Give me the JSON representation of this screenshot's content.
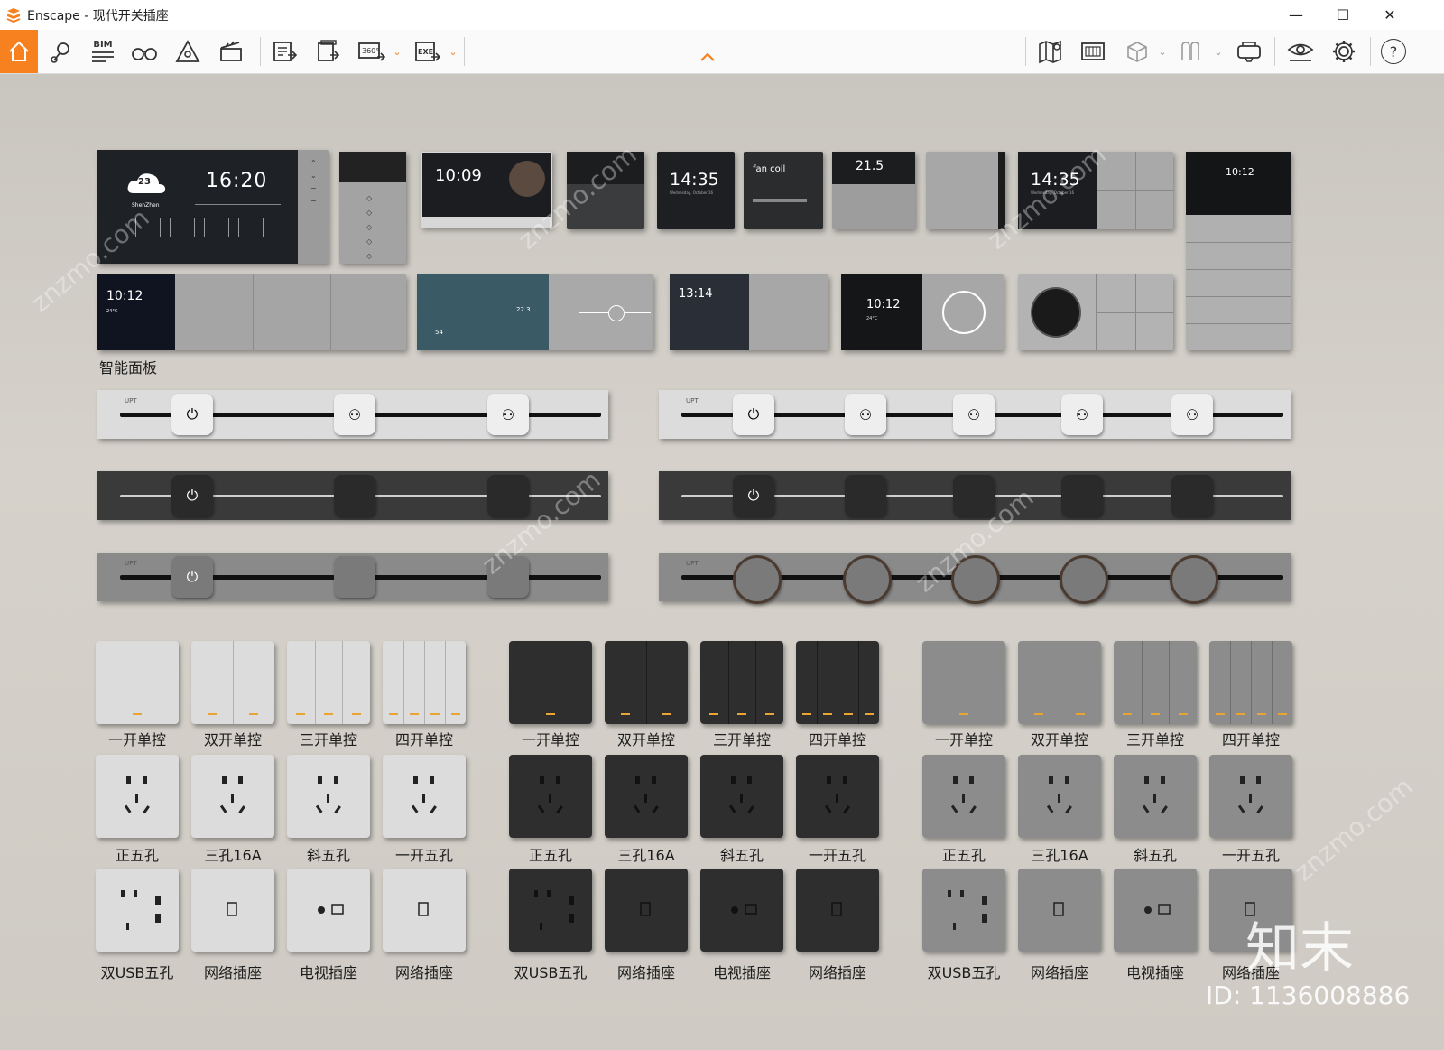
{
  "app": {
    "name": "Enscape",
    "title": "Enscape - 现代开关插座"
  },
  "window_controls": {
    "minimize": "—",
    "maximize": "☐",
    "close": "✕"
  },
  "toolbar": {
    "left_icons": [
      "home-icon",
      "location-pin-icon",
      "bim-icon",
      "binoculars-icon",
      "perspective-icon",
      "clapperboard-icon",
      "screenshot-export-icon",
      "batch-export-icon",
      "panorama-360-icon",
      "exe-export-icon"
    ],
    "bim_label": "BIM",
    "pano_label": "360°",
    "exe_label": "EXE",
    "collapse_caret": "⌃",
    "right_icons": [
      "map-icon",
      "info-board-icon",
      "cube-icon",
      "asset-library-icon",
      "vr-headset-icon",
      "visual-settings-eye-icon",
      "settings-gear-icon",
      "help-icon"
    ],
    "help_label": "?",
    "accent_color": "#f7801f"
  },
  "scene": {
    "smart_panel_section_label": "智能面板",
    "screens": {
      "s1_time": "16:20",
      "s1_temp": "23",
      "s1_city": "ShenZhen",
      "s3_time": "10:09",
      "s5_time": "14:35",
      "s5_date": "Wednesday, October 16",
      "s6_title": "fan coil",
      "s7_temp": "21.5",
      "s8_time": "14:35",
      "s8_date": "Wednesday, October 16",
      "s9_time": "10:12",
      "r2_s1_time": "10:12",
      "r2_s1_temp": "24°C",
      "r2_s2_num1": "54",
      "r2_s2_num2": "22.3",
      "r2_s3_time": "13:14",
      "r2_s4_time": "10:12",
      "r2_s4_temp": "24°C"
    },
    "rail_label": "UPT",
    "switch_labels": [
      "一开单控",
      "双开单控",
      "三开单控",
      "四开单控"
    ],
    "socket_labels": [
      "正五孔",
      "三孔16A",
      "斜五孔",
      "一开五孔"
    ],
    "extra_labels": [
      "双USB五孔",
      "网络插座",
      "电视插座",
      "网络插座"
    ],
    "watermark_logo": "知末",
    "watermark_site": "znzmo.com",
    "image_id": "ID: 1136008886"
  }
}
